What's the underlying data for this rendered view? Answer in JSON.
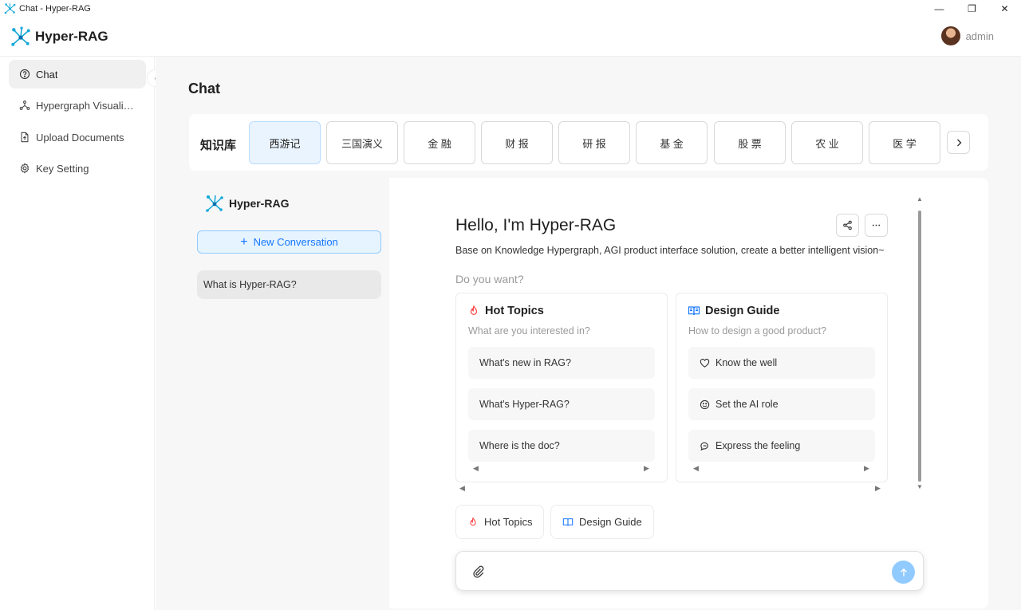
{
  "window": {
    "title": "Chat - Hyper-RAG",
    "controls": {
      "minimize": "—",
      "restore": "❐",
      "close": "✕"
    }
  },
  "header": {
    "app_name": "Hyper-RAG",
    "user_name": "admin"
  },
  "sidebar": {
    "items": [
      {
        "label": "Chat",
        "icon": "help-circle-icon",
        "active": true
      },
      {
        "label": "Hypergraph Visualization",
        "icon": "hypergraph-icon",
        "active": false
      },
      {
        "label": "Upload Documents",
        "icon": "file-upload-icon",
        "active": false
      },
      {
        "label": "Key Setting",
        "icon": "gear-icon",
        "active": false
      }
    ],
    "collapse_icon": "‹"
  },
  "main": {
    "page_title": "Chat",
    "knowledge_base": {
      "label": "知识库",
      "tabs": [
        "西游记",
        "三国演义",
        "金 融",
        "财 报",
        "研 报",
        "基 金",
        "股 票",
        "农 业",
        "医 学"
      ],
      "active_index": 0
    },
    "conversations": {
      "app_name": "Hyper-RAG",
      "new_button": "New Conversation",
      "items": [
        "What is Hyper-RAG?"
      ]
    },
    "chat": {
      "greeting": "Hello, I'm Hyper-RAG",
      "description": "Base on Knowledge Hypergraph, AGI product interface solution, create a better intelligent vision~",
      "prompt_label": "Do you want?",
      "cards": [
        {
          "title": "Hot Topics",
          "subtitle": "What are you interested in?",
          "icon": "fire-icon",
          "items": [
            "What's new in RAG?",
            "What's Hyper-RAG?",
            "Where is the doc?"
          ]
        },
        {
          "title": "Design Guide",
          "subtitle": "How to design a good product?",
          "icon": "book-icon",
          "items": [
            "Know the well",
            "Set the AI role",
            "Express the feeling"
          ]
        }
      ],
      "tags": [
        "Hot Topics",
        "Design Guide"
      ],
      "input_placeholder": ""
    }
  },
  "colors": {
    "accent": "#1677ff",
    "accent_light": "#e6f4ff",
    "send_button": "#91caff",
    "logo": "#13a8d8",
    "fire": "#ff4d4f"
  }
}
